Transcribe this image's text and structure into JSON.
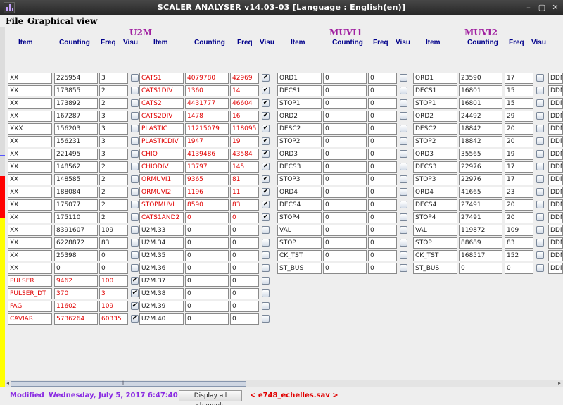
{
  "window": {
    "title": "SCALER ANALYSER v14.03-03 [Language : English(en)]"
  },
  "menu": [
    "File",
    "Graphical view"
  ],
  "sections": {
    "u2m": "U2M",
    "muvi1": "MUVI1",
    "muvi2": "MUVI2"
  },
  "headers": {
    "item": "Item",
    "counting": "Counting",
    "freq": "Freq",
    "visu": "Visu"
  },
  "group1": [
    {
      "item": "XX",
      "counting": "225954",
      "freq": "3",
      "visu": false,
      "red": false
    },
    {
      "item": "XX",
      "counting": "173855",
      "freq": "2",
      "visu": false,
      "red": false
    },
    {
      "item": "XX",
      "counting": "173892",
      "freq": "2",
      "visu": false,
      "red": false
    },
    {
      "item": "XX",
      "counting": "167287",
      "freq": "3",
      "visu": false,
      "red": false
    },
    {
      "item": "XXX",
      "counting": "156203",
      "freq": "3",
      "visu": false,
      "red": false
    },
    {
      "item": "XX",
      "counting": "156231",
      "freq": "3",
      "visu": false,
      "red": false
    },
    {
      "item": "XX",
      "counting": "221495",
      "freq": "3",
      "visu": false,
      "red": false
    },
    {
      "item": "XX",
      "counting": "148562",
      "freq": "2",
      "visu": false,
      "red": false
    },
    {
      "item": "XX",
      "counting": "148585",
      "freq": "2",
      "visu": false,
      "red": false
    },
    {
      "item": "XX",
      "counting": "188084",
      "freq": "2",
      "visu": false,
      "red": false
    },
    {
      "item": "XX",
      "counting": "175077",
      "freq": "2",
      "visu": false,
      "red": false
    },
    {
      "item": "XX",
      "counting": "175110",
      "freq": "2",
      "visu": false,
      "red": false
    },
    {
      "item": "XX",
      "counting": "8391607",
      "freq": "109",
      "visu": false,
      "red": false
    },
    {
      "item": "XX",
      "counting": "6228872",
      "freq": "83",
      "visu": false,
      "red": false
    },
    {
      "item": "XX",
      "counting": "25398",
      "freq": "0",
      "visu": false,
      "red": false
    },
    {
      "item": "XX",
      "counting": "0",
      "freq": "0",
      "visu": false,
      "red": false
    },
    {
      "item": "PULSER",
      "counting": "9462",
      "freq": "100",
      "visu": true,
      "red": true
    },
    {
      "item": "PULSER_DT",
      "counting": "370",
      "freq": "3",
      "visu": true,
      "red": true
    },
    {
      "item": "FAG",
      "counting": "11602",
      "freq": "109",
      "visu": true,
      "red": true
    },
    {
      "item": "CAVIAR",
      "counting": "5736264",
      "freq": "60335",
      "visu": true,
      "red": true
    }
  ],
  "u2m": [
    {
      "item": "CATS1",
      "counting": "4079780",
      "freq": "42969",
      "visu": true,
      "red": true
    },
    {
      "item": "CATS1DIV",
      "counting": "1360",
      "freq": "14",
      "visu": true,
      "red": true
    },
    {
      "item": "CATS2",
      "counting": "4431777",
      "freq": "46604",
      "visu": true,
      "red": true
    },
    {
      "item": "CATS2DIV",
      "counting": "1478",
      "freq": "16",
      "visu": true,
      "red": true
    },
    {
      "item": "PLASTIC",
      "counting": "11215079",
      "freq": "118095",
      "visu": true,
      "red": true
    },
    {
      "item": "PLASTICDIV",
      "counting": "1947",
      "freq": "19",
      "visu": true,
      "red": true
    },
    {
      "item": "CHIO",
      "counting": "4139486",
      "freq": "43584",
      "visu": true,
      "red": true
    },
    {
      "item": "CHIODIV",
      "counting": "13797",
      "freq": "145",
      "visu": true,
      "red": true
    },
    {
      "item": "ORMUVI1",
      "counting": "9365",
      "freq": "81",
      "visu": true,
      "red": true
    },
    {
      "item": "ORMUVI2",
      "counting": "1196",
      "freq": "11",
      "visu": true,
      "red": true
    },
    {
      "item": "STOPMUVI",
      "counting": "8590",
      "freq": "83",
      "visu": true,
      "red": true
    },
    {
      "item": "CATS1AND2",
      "counting": "0",
      "freq": "0",
      "visu": true,
      "red": true
    },
    {
      "item": "U2M.33",
      "counting": "0",
      "freq": "0",
      "visu": false,
      "red": false
    },
    {
      "item": "U2M.34",
      "counting": "0",
      "freq": "0",
      "visu": false,
      "red": false
    },
    {
      "item": "U2M.35",
      "counting": "0",
      "freq": "0",
      "visu": false,
      "red": false
    },
    {
      "item": "U2M.36",
      "counting": "0",
      "freq": "0",
      "visu": false,
      "red": false
    },
    {
      "item": "U2M.37",
      "counting": "0",
      "freq": "0",
      "visu": false,
      "red": false
    },
    {
      "item": "U2M.38",
      "counting": "0",
      "freq": "0",
      "visu": false,
      "red": false
    },
    {
      "item": "U2M.39",
      "counting": "0",
      "freq": "0",
      "visu": false,
      "red": false
    },
    {
      "item": "U2M.40",
      "counting": "0",
      "freq": "0",
      "visu": false,
      "red": false
    }
  ],
  "muvi1": [
    {
      "item": "ORD1",
      "counting": "0",
      "freq": "0",
      "visu": false
    },
    {
      "item": "DECS1",
      "counting": "0",
      "freq": "0",
      "visu": false
    },
    {
      "item": "STOP1",
      "counting": "0",
      "freq": "0",
      "visu": false
    },
    {
      "item": "ORD2",
      "counting": "0",
      "freq": "0",
      "visu": false
    },
    {
      "item": "DESC2",
      "counting": "0",
      "freq": "0",
      "visu": false
    },
    {
      "item": "STOP2",
      "counting": "0",
      "freq": "0",
      "visu": false
    },
    {
      "item": "ORD3",
      "counting": "0",
      "freq": "0",
      "visu": false
    },
    {
      "item": "DECS3",
      "counting": "0",
      "freq": "0",
      "visu": false
    },
    {
      "item": "STOP3",
      "counting": "0",
      "freq": "0",
      "visu": false
    },
    {
      "item": "ORD4",
      "counting": "0",
      "freq": "0",
      "visu": false
    },
    {
      "item": "DECS4",
      "counting": "0",
      "freq": "0",
      "visu": false
    },
    {
      "item": "STOP4",
      "counting": "0",
      "freq": "0",
      "visu": false
    },
    {
      "item": "VAL",
      "counting": "0",
      "freq": "0",
      "visu": false
    },
    {
      "item": "STOP",
      "counting": "0",
      "freq": "0",
      "visu": false
    },
    {
      "item": "CK_TST",
      "counting": "0",
      "freq": "0",
      "visu": false
    },
    {
      "item": "ST_BUS",
      "counting": "0",
      "freq": "0",
      "visu": false
    }
  ],
  "muvi2": [
    {
      "item": "ORD1",
      "counting": "23590",
      "freq": "17",
      "visu": false,
      "next": "DDM"
    },
    {
      "item": "DECS1",
      "counting": "16801",
      "freq": "15",
      "visu": false,
      "next": "DDM"
    },
    {
      "item": "STOP1",
      "counting": "16801",
      "freq": "15",
      "visu": false,
      "next": "DDM"
    },
    {
      "item": "ORD2",
      "counting": "24492",
      "freq": "29",
      "visu": false,
      "next": "DDM"
    },
    {
      "item": "DESC2",
      "counting": "18842",
      "freq": "20",
      "visu": false,
      "next": "DDM"
    },
    {
      "item": "STOP2",
      "counting": "18842",
      "freq": "20",
      "visu": false,
      "next": "DDM"
    },
    {
      "item": "ORD3",
      "counting": "35565",
      "freq": "19",
      "visu": false,
      "next": "DDM"
    },
    {
      "item": "DECS3",
      "counting": "22976",
      "freq": "17",
      "visu": false,
      "next": "DDM"
    },
    {
      "item": "STOP3",
      "counting": "22976",
      "freq": "17",
      "visu": false,
      "next": "DDM"
    },
    {
      "item": "ORD4",
      "counting": "41665",
      "freq": "23",
      "visu": false,
      "next": "DDM"
    },
    {
      "item": "DECS4",
      "counting": "27491",
      "freq": "20",
      "visu": false,
      "next": "DDM"
    },
    {
      "item": "STOP4",
      "counting": "27491",
      "freq": "20",
      "visu": false,
      "next": "DDM"
    },
    {
      "item": "VAL",
      "counting": "119872",
      "freq": "109",
      "visu": false,
      "next": "DDM"
    },
    {
      "item": "STOP",
      "counting": "88689",
      "freq": "83",
      "visu": false,
      "next": "DDM"
    },
    {
      "item": "CK_TST",
      "counting": "168517",
      "freq": "152",
      "visu": false,
      "next": "DDM"
    },
    {
      "item": "ST_BUS",
      "counting": "0",
      "freq": "0",
      "visu": false,
      "next": "DDM"
    }
  ],
  "status": {
    "modified": "Modified",
    "datetime": "Wednesday, July 5, 2017 6:47:40 PM",
    "display_all": "Display all channels",
    "file": "< e748_echelles.sav >"
  },
  "colors": {
    "section": "#a020a0",
    "header": "#00008b",
    "active": "#e00000",
    "status": "#8a2be2"
  }
}
